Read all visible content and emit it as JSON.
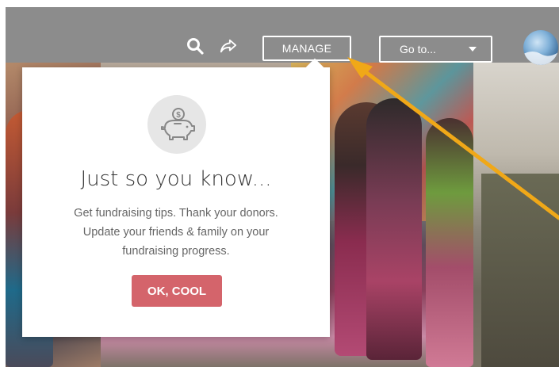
{
  "header": {
    "icons": {
      "search": "search-icon",
      "share": "share-arrow-icon"
    },
    "manage_label": "MANAGE",
    "goto_label": "Go to...",
    "avatar": "profile-avatar"
  },
  "popup": {
    "icon": "piggy-bank-icon",
    "title": "Just so you know...",
    "body_lines": [
      "Get fundraising tips. Thank your donors.",
      "Update your friends & family on your",
      "fundraising progress."
    ],
    "confirm_label": "OK, COOL"
  },
  "annotation": {
    "color": "#f0a818"
  },
  "colors": {
    "accent_button": "#d4646b",
    "topbar": "#8c8c8c"
  }
}
